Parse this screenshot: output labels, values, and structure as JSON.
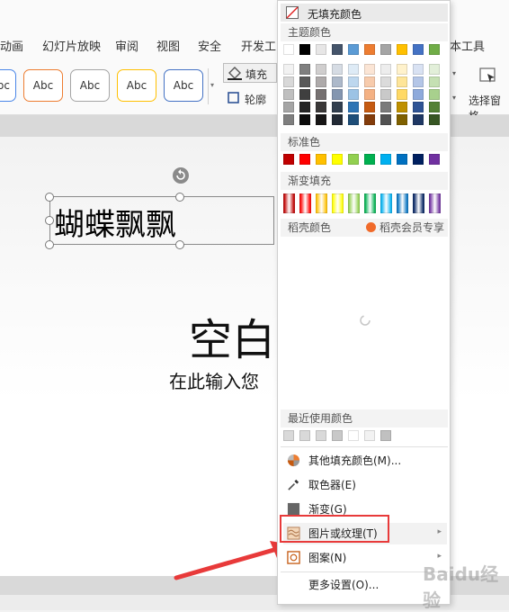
{
  "tabs": [
    "动画",
    "幻灯片放映",
    "审阅",
    "视图",
    "安全",
    "开发工",
    "本工具"
  ],
  "ribbon": {
    "style_labels": [
      "Abc",
      "Abc",
      "Abc",
      "Abc",
      "Abc"
    ],
    "fill_label": "填充",
    "outline_label": "轮廓",
    "select_pane_label": "选择窗格"
  },
  "slide": {
    "textbox_text": "蝴蝶飘飘",
    "title_text": "空白",
    "subtitle_text": "在此输入您"
  },
  "menu": {
    "no_fill": "无填充颜色",
    "theme_colors": "主题颜色",
    "theme_rows": [
      [
        "#ffffff",
        "#000000",
        "#e7e6e6",
        "#44546a",
        "#5b9bd5",
        "#ed7d31",
        "#a5a5a5",
        "#ffc000",
        "#4472c4",
        "#70ad47"
      ],
      [
        "#f2f2f2",
        "#7f7f7f",
        "#d0cece",
        "#d6dce4",
        "#deebf6",
        "#fbe5d5",
        "#ededed",
        "#fff2cc",
        "#d9e2f3",
        "#e2efd9"
      ],
      [
        "#d8d8d8",
        "#595959",
        "#aeaaaa",
        "#adb9ca",
        "#bdd7ee",
        "#f7cbac",
        "#dbdbdb",
        "#fee599",
        "#b4c6e7",
        "#c5e0b3"
      ],
      [
        "#bfbfbf",
        "#3f3f3f",
        "#757070",
        "#8496b0",
        "#9cc3e5",
        "#f4b183",
        "#c9c9c9",
        "#ffd965",
        "#8eaadb",
        "#a8d08d"
      ],
      [
        "#a5a5a5",
        "#262626",
        "#3a3838",
        "#323f4f",
        "#2e75b5",
        "#c55a11",
        "#7b7b7b",
        "#bf9000",
        "#2f5496",
        "#538135"
      ],
      [
        "#7f7f7f",
        "#0c0c0c",
        "#171616",
        "#222a35",
        "#1e4e79",
        "#833c0b",
        "#525252",
        "#7f6000",
        "#1f3864",
        "#375623"
      ]
    ],
    "standard_colors_label": "标准色",
    "standard_colors": [
      "#c00000",
      "#ff0000",
      "#ffc000",
      "#ffff00",
      "#92d050",
      "#00b050",
      "#00b0f0",
      "#0070c0",
      "#002060",
      "#7030a0"
    ],
    "gradient_fill_label": "渐变填充",
    "gradient_colors": [
      "#c00000",
      "#ff0000",
      "#ffc000",
      "#ffff00",
      "#92d050",
      "#00b050",
      "#00b0f0",
      "#0070c0",
      "#002060",
      "#7030a0"
    ],
    "docer_colors_label": "稻壳颜色",
    "docer_vip_label": "稻壳会员专享",
    "recent_colors_label": "最近使用颜色",
    "recent_colors": [
      "#d9d9d9",
      "#d9d9d9",
      "#d9d9d9",
      "#c8c8c8",
      "#ffffff",
      "#f2f2f2",
      "#c0c0c0"
    ],
    "items": {
      "more_colors": "其他填充颜色(M)...",
      "eyedropper": "取色器(E)",
      "gradient": "渐变(G)",
      "picture_texture": "图片或纹理(T)",
      "pattern": "图案(N)",
      "more_settings": "更多设置(O)..."
    }
  },
  "watermark": "Baidu经验"
}
